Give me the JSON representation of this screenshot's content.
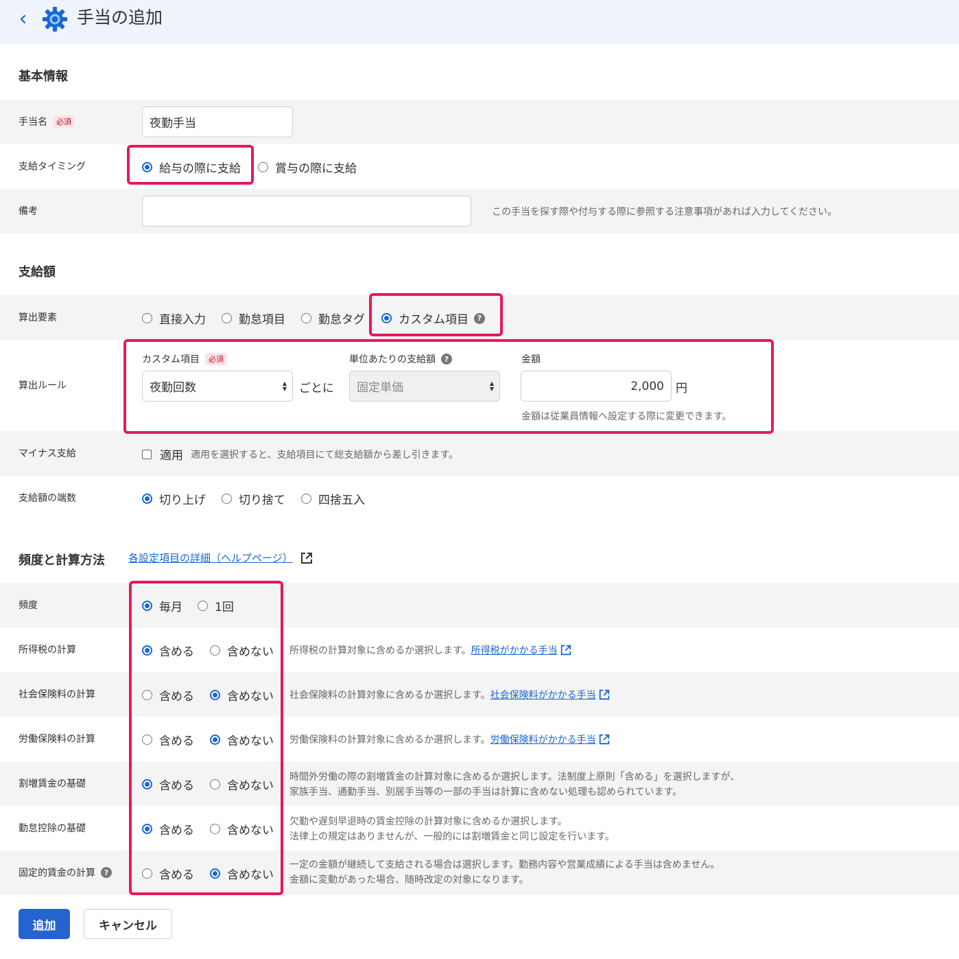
{
  "header": {
    "title": "手当の追加"
  },
  "basic": {
    "title": "基本情報",
    "name_label": "手当名",
    "required": "必須",
    "name_value": "夜勤手当",
    "timing_label": "支給タイミング",
    "timing_options": [
      "給与の際に支給",
      "賞与の際に支給"
    ],
    "memo_label": "備考",
    "memo_value": "",
    "memo_note": "この手当を探す際や付与する際に参照する注意事項があれば入力してください。"
  },
  "amount": {
    "title": "支給額",
    "element_label": "算出要素",
    "element_options": [
      "直接入力",
      "勤怠項目",
      "勤怠タグ",
      "カスタム項目"
    ],
    "rule_label": "算出ルール",
    "custom_label": "カスタム項目",
    "custom_value": "夜勤回数",
    "per_text": "ごとに",
    "unit_label": "単位あたりの支給額",
    "unit_value": "固定単価",
    "money_label": "金額",
    "money_value": "2,000",
    "yen": "円",
    "money_note": "金額は従業員情報へ設定する際に変更できます。",
    "minus_label": "マイナス支給",
    "minus_option": "適用",
    "minus_note": "適用を選択すると、支給項目にて総支給額から差し引きます。",
    "rounding_label": "支給額の端数",
    "rounding_options": [
      "切り上げ",
      "切り捨て",
      "四捨五入"
    ]
  },
  "freq": {
    "title": "頻度と計算方法",
    "help_link": "各設定項目の詳細（ヘルプページ）",
    "freq_label": "頻度",
    "freq_options": [
      "毎月",
      "1回"
    ],
    "include": "含める",
    "exclude": "含めない",
    "rows": [
      {
        "label": "所得税の計算",
        "note": "所得税の計算対象に含めるか選択します。",
        "link": "所得税がかかる手当",
        "note2": ""
      },
      {
        "label": "社会保険料の計算",
        "note": "社会保険料の計算対象に含めるか選択します。",
        "link": "社会保険料がかかる手当",
        "note2": ""
      },
      {
        "label": "労働保険料の計算",
        "note": "労働保険料の計算対象に含めるか選択します。",
        "link": "労働保険料がかかる手当",
        "note2": ""
      },
      {
        "label": "割増賃金の基礎",
        "note": "時間外労働の際の割増賃金の計算対象に含めるか選択します。法制度上原則「含める」を選択しますが、",
        "link": "",
        "note2": "家族手当、通勤手当、別居手当等の一部の手当は計算に含めない処理も認められています。"
      },
      {
        "label": "勤怠控除の基礎",
        "note": "欠勤や遅刻早退時の賃金控除の計算対象に含めるか選択します。",
        "link": "",
        "note2": "法律上の規定はありませんが、一般的には割増賃金と同じ設定を行います。"
      },
      {
        "label": "固定的賃金の計算",
        "note": "一定の金額が継続して支給される場合は選択します。勤務内容や営業成績による手当は含めません。",
        "link": "",
        "note2": "金額に変動があった場合、随時改定の対象になります。"
      }
    ]
  },
  "actions": {
    "add": "追加",
    "cancel": "キャンセル"
  },
  "colors": {
    "accent": "#1a66d6",
    "highlight": "#e8175d",
    "header_bg": "#eef3fc",
    "row_gray": "#f4f4f4"
  }
}
